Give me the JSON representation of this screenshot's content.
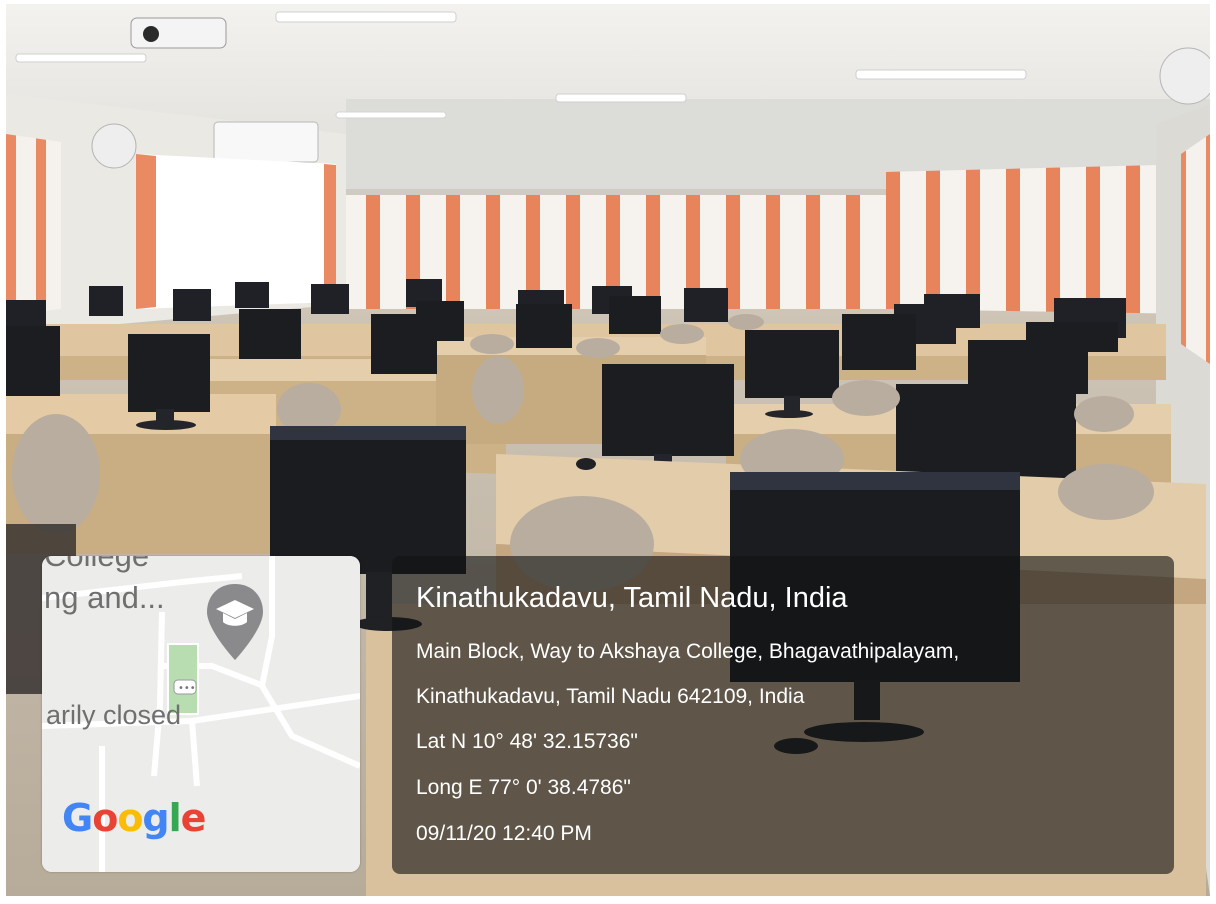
{
  "map": {
    "label_top": "College",
    "label_name": "ng and...",
    "label_status": "arily closed",
    "pin_icon": "graduation-cap-pin-icon",
    "pin_color": "#8a8a8c",
    "google_logo": "Google",
    "google_colors": [
      "#4285F4",
      "#EA4335",
      "#FBBC05",
      "#4285F4",
      "#34A853",
      "#EA4335"
    ]
  },
  "location": {
    "title": "Kinathukadavu, Tamil Nadu, India",
    "address_line1": "Main Block, Way to Akshaya College, Bhagavathipalayam,",
    "address_line2": "Kinathukadavu, Tamil Nadu 642109, India",
    "latitude": "Lat N 10° 48' 32.15736\"",
    "longitude": "Long E 77° 0' 38.4786\"",
    "timestamp": "09/11/20 12:40 PM"
  },
  "scene": {
    "description_colors": {
      "wall": "#e8e6e1",
      "blind_orange": "#e8845c",
      "blind_white": "#f4f1ec",
      "desk": "#e2c9a3",
      "monitor": "#1d1f23",
      "chair": "#b9ada0"
    }
  }
}
